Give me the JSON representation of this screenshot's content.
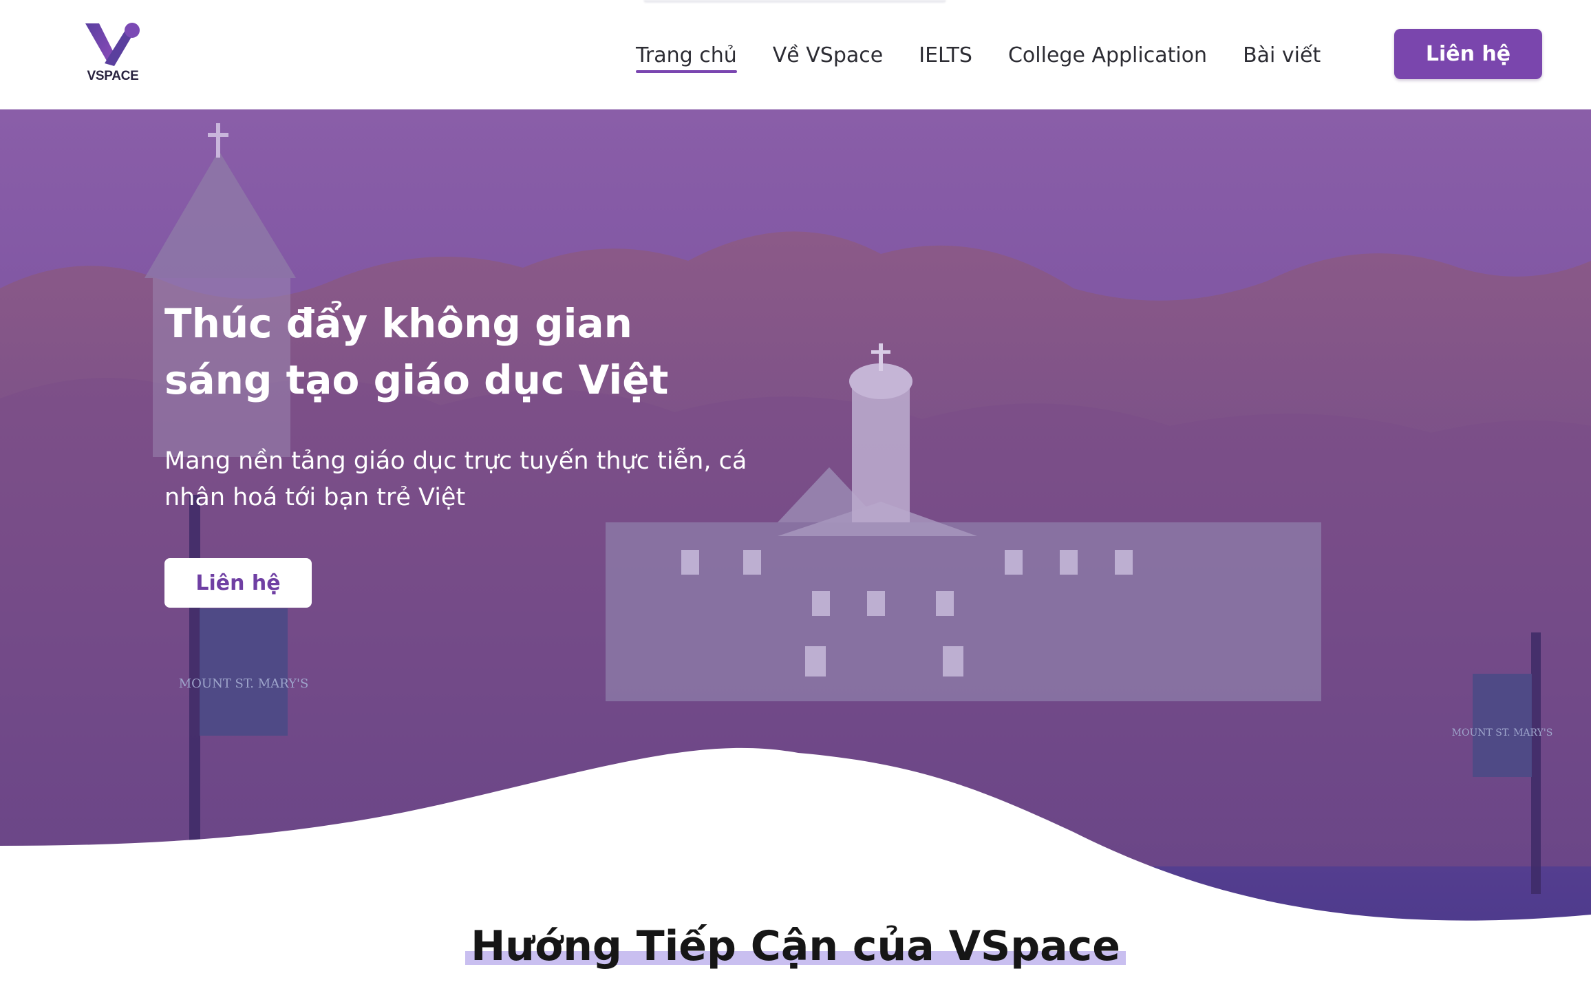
{
  "brand": {
    "logo_text": "VSPACE",
    "primary_color": "#7a46ad",
    "highlight_color": "#c9bff0"
  },
  "nav": {
    "items": [
      {
        "label": "Trang chủ",
        "active": true
      },
      {
        "label": "Về VSpace",
        "active": false
      },
      {
        "label": "IELTS",
        "active": false
      },
      {
        "label": "College Application",
        "active": false
      },
      {
        "label": "Bài viết",
        "active": false
      }
    ],
    "cta_label": "Liên hệ"
  },
  "hero": {
    "title_line1": "Thúc đẩy không gian",
    "title_line2": "sáng tạo giáo dục Việt",
    "subtitle_line1": "Mang nền tảng giáo dục trực tuyến thực tiễn, cá",
    "subtitle_line2": "nhân hoá tới bạn trẻ Việt",
    "cta_label": "Liên hệ",
    "banner_left_text": "MOUNT ST. MARY'S",
    "banner_right_text": "MOUNT ST. MARY'S"
  },
  "section": {
    "title": "Hướng Tiếp Cận của VSpace"
  }
}
